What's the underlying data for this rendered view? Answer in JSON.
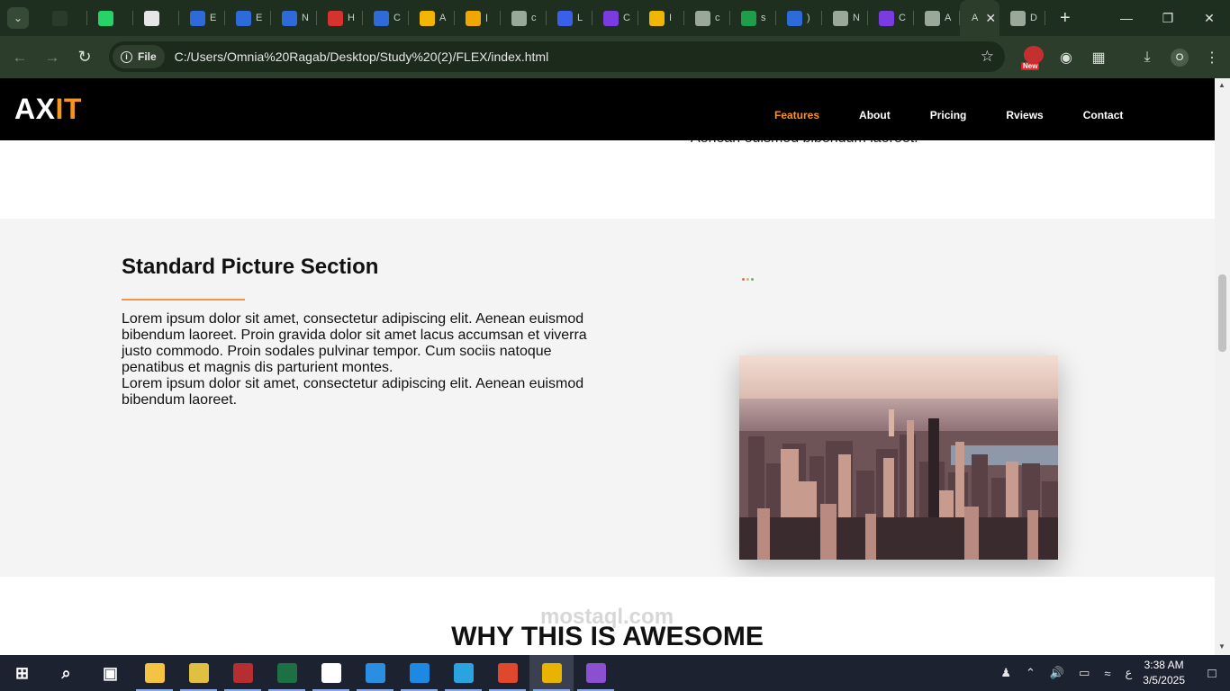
{
  "browser": {
    "tabs": [
      {
        "icon": "fiverr-favicon-icon",
        "title": "",
        "color": "#2b3b2b"
      },
      {
        "icon": "whatsapp-favicon-icon",
        "title": "",
        "color": "#25d366"
      },
      {
        "icon": "chatgpt-favicon-icon",
        "title": "",
        "color": "#e6e6e6"
      },
      {
        "icon": "notion-favicon-icon",
        "title": "E",
        "color": "#2f6bd8"
      },
      {
        "icon": "notion-favicon-icon",
        "title": "E",
        "color": "#2f6bd8"
      },
      {
        "icon": "notion-favicon-icon",
        "title": "N",
        "color": "#2f6bd8"
      },
      {
        "icon": "hsu-favicon-icon",
        "title": "H",
        "color": "#d6322e"
      },
      {
        "icon": "chart-favicon-icon",
        "title": "C",
        "color": "#2f6bd8"
      },
      {
        "icon": "drive-favicon-icon",
        "title": "A",
        "color": "#f2b600"
      },
      {
        "icon": "five-favicon-icon",
        "title": "ا",
        "color": "#f2a600"
      },
      {
        "icon": "globe-favicon-icon",
        "title": "c",
        "color": "#9aa89a"
      },
      {
        "icon": "video-favicon-icon",
        "title": "L",
        "color": "#3860e8"
      },
      {
        "icon": "p-favicon-icon",
        "title": "C",
        "color": "#7a3be0"
      },
      {
        "icon": "slides-favicon-icon",
        "title": "I",
        "color": "#f2b600"
      },
      {
        "icon": "globe-favicon-icon",
        "title": "c",
        "color": "#9aa89a"
      },
      {
        "icon": "classroom-favicon-icon",
        "title": "s",
        "color": "#1e9e4a"
      },
      {
        "icon": "quora-favicon-icon",
        "title": ")",
        "color": "#2f6bd8"
      },
      {
        "icon": "chrome-favicon-icon",
        "title": "N",
        "color": "#9aa89a"
      },
      {
        "icon": "p-favicon-icon",
        "title": "C",
        "color": "#7a3be0"
      },
      {
        "icon": "globe-favicon-icon",
        "title": "A",
        "color": "#9aa89a"
      }
    ],
    "active_tab": {
      "title": "A"
    },
    "last_tab": {
      "title": "D"
    },
    "address": {
      "scheme_label": "File",
      "url": "C:/Users/Omnia%20Ragab/Desktop/Study%20(2)/FLEX/index.html"
    },
    "extension_badge": "New",
    "profile_initial": "O"
  },
  "page": {
    "prev_section_text": "Aenean euismod bibendum laoreet.",
    "logo": {
      "main": "AX",
      "accent": "IT"
    },
    "nav": [
      {
        "label": "Features",
        "active": true
      },
      {
        "label": "About",
        "active": false
      },
      {
        "label": "Pricing",
        "active": false
      },
      {
        "label": "Rviews",
        "active": false
      },
      {
        "label": "Contact",
        "active": false
      }
    ],
    "feature": {
      "title": "Standard Picture Section",
      "paragraph_1": "Lorem ipsum dolor sit amet, consectetur adipiscing elit. Aenean euismod bibendum laoreet. Proin gravida dolor sit amet lacus accumsan et viverra justo commodo. Proin sodales pulvinar tempor. Cum sociis natoque penatibus et magnis dis parturient montes.",
      "paragraph_2": "Lorem ipsum dolor sit amet, consectetur adipiscing elit. Aenean euismod bibendum laoreet.",
      "image_alt_icon": "city-skyline-image"
    },
    "next_section_title": "WHY THIS IS AWESOME",
    "accent_color": "#f7941d"
  },
  "taskbar": {
    "apps": [
      {
        "icon": "windows-start-icon",
        "color": "#ffffff"
      },
      {
        "icon": "search-icon",
        "color": "#ffffff"
      },
      {
        "icon": "task-view-icon",
        "color": "#ffffff"
      },
      {
        "icon": "file-explorer-icon",
        "color": "#f5c342"
      },
      {
        "icon": "paint-icon",
        "color": "#e0c040"
      },
      {
        "icon": "access-icon",
        "color": "#b52e31"
      },
      {
        "icon": "excel-icon",
        "color": "#1d7044"
      },
      {
        "icon": "notion-icon",
        "color": "#ffffff"
      },
      {
        "icon": "vscode-icon",
        "color": "#2a8fe0"
      },
      {
        "icon": "edge-icon",
        "color": "#1e88e5"
      },
      {
        "icon": "telegram-icon",
        "color": "#2aa3e0"
      },
      {
        "icon": "office-icon",
        "color": "#e0482e"
      },
      {
        "icon": "chrome-icon",
        "color": "#e8b400"
      },
      {
        "icon": "visual-studio-icon",
        "color": "#8a50d0"
      }
    ],
    "clock": {
      "time": "3:38 AM",
      "date": "3/5/2025"
    },
    "lang": "ع"
  },
  "watermark": "mostaql.com"
}
